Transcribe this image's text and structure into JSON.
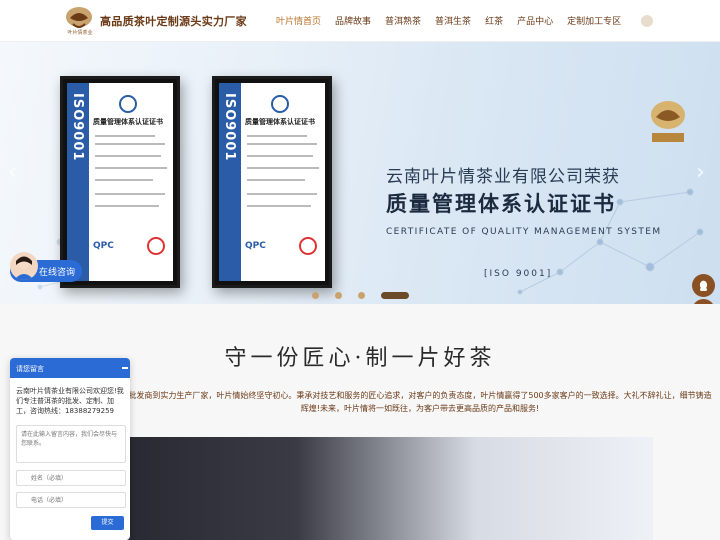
{
  "header": {
    "logo_text": "叶片情茶业",
    "slogan": "高品质茶叶定制源头实力厂家",
    "nav": [
      {
        "label": "叶片情首页",
        "active": true
      },
      {
        "label": "品牌故事"
      },
      {
        "label": "普洱熟茶"
      },
      {
        "label": "普洱生茶"
      },
      {
        "label": "红茶"
      },
      {
        "label": "产品中心"
      },
      {
        "label": "定制加工专区"
      }
    ]
  },
  "banner": {
    "line1": "云南叶片情茶业有限公司荣获",
    "line2": "质量管理体系认证证书",
    "line3": "CERTIFICATE OF QUALITY MANAGEMENT SYSTEM",
    "line4": "[ISO 9001]",
    "brand_badge": "叶片情",
    "cert_band": "ISO9001",
    "cert_title": "质量管理体系认证证书",
    "cert_qpc": "QPC",
    "cert_company": "云南叶片情茶业有限公司",
    "cert_issuer": "浙江全盛认证有限公司",
    "arrow_left": "‹",
    "arrow_right": "›",
    "slide_count": 4,
    "active_slide": 4
  },
  "consult": {
    "label": "在线咨询"
  },
  "section": {
    "title": "守一份匠心·制一片好茶",
    "description": "批发商到实力生产厂家，叶片情始终坚守初心。秉承对技艺和服务的匠心追求，对客户的负责态度，叶片情赢得了500多家客户的一致选择。大礼不辞礼让，细节铸造辉煌!未来，叶片情将一如既往，为客户带去更高品质的产品和服务!"
  },
  "chat": {
    "title": "请您留言",
    "message": "云南叶片情茶业有限公司欢迎您!我们专注普洱茶的批发、定制、加工，咨询热线：18388279259",
    "textarea_placeholder": "请在此输入留言内容，我们会尽快与您联系。",
    "name_placeholder": "姓名（必填）",
    "phone_placeholder": "电话（必填）",
    "submit_label": "提交"
  },
  "colors": {
    "brand_brown": "#6b3a17",
    "accent_gold": "#b8742c",
    "chat_blue": "#2b6bd6",
    "side_button": "#8a5125"
  },
  "side_buttons": [
    "qq-icon",
    "wechat-icon",
    "phone-icon",
    "home-icon"
  ]
}
